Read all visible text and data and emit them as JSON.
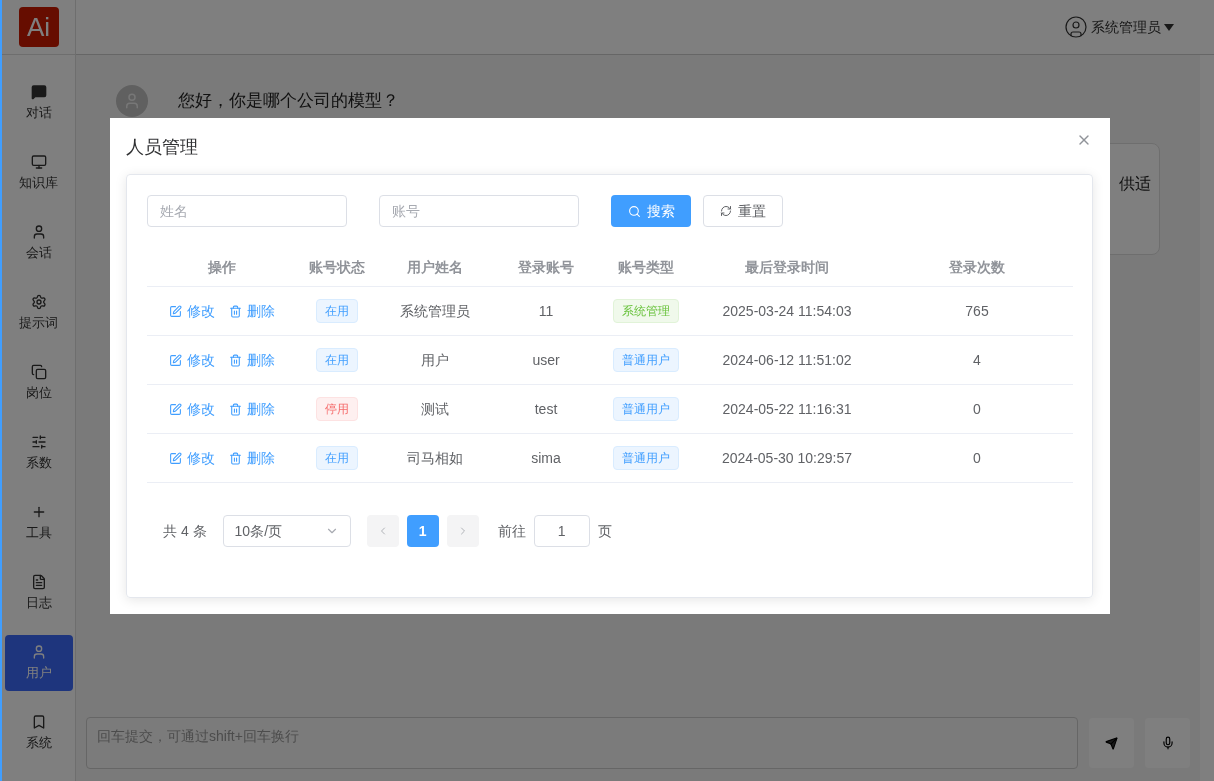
{
  "logo": "Ai",
  "sidebar": {
    "items": [
      {
        "label": "对话",
        "selected": false
      },
      {
        "label": "知识库",
        "selected": false
      },
      {
        "label": "会话",
        "selected": false
      },
      {
        "label": "提示词",
        "selected": false
      },
      {
        "label": "岗位",
        "selected": false
      },
      {
        "label": "系数",
        "selected": false
      },
      {
        "label": "工具",
        "selected": false
      },
      {
        "label": "日志",
        "selected": false
      },
      {
        "label": "用户",
        "selected": true
      },
      {
        "label": "系统",
        "selected": false
      }
    ]
  },
  "header": {
    "user": "系统管理员"
  },
  "chat": {
    "question": "您好，你是哪个公司的模型？",
    "answer_fragment": "供适"
  },
  "composer": {
    "placeholder": "回车提交，可通过shift+回车换行"
  },
  "modal": {
    "title": "人员管理",
    "filters": [
      {
        "placeholder": "姓名"
      },
      {
        "placeholder": "账号"
      }
    ],
    "search_button": "搜索",
    "reset_button": "重置",
    "table": {
      "columns": [
        "操作",
        "账号状态",
        "用户姓名",
        "登录账号",
        "账号类型",
        "最后登录时间",
        "登录次数"
      ],
      "rows": [
        {
          "edit": "修改",
          "delete": "删除",
          "status": {
            "text": "在用",
            "kind": "active"
          },
          "name": "系统管理员",
          "account": "11",
          "type": {
            "text": "系统管理",
            "kind": "admin"
          },
          "last_login": "2025-03-24 11:54:03",
          "count": "765"
        },
        {
          "edit": "修改",
          "delete": "删除",
          "status": {
            "text": "在用",
            "kind": "active"
          },
          "name": "用户",
          "account": "user",
          "type": {
            "text": "普通用户",
            "kind": "normal"
          },
          "last_login": "2024-06-12 11:51:02",
          "count": "4"
        },
        {
          "edit": "修改",
          "delete": "删除",
          "status": {
            "text": "停用",
            "kind": "disabled"
          },
          "name": "测试",
          "account": "test",
          "type": {
            "text": "普通用户",
            "kind": "normal"
          },
          "last_login": "2024-05-22 11:16:31",
          "count": "0"
        },
        {
          "edit": "修改",
          "delete": "删除",
          "status": {
            "text": "在用",
            "kind": "active"
          },
          "name": "司马相如",
          "account": "sima",
          "type": {
            "text": "普通用户",
            "kind": "normal"
          },
          "last_login": "2024-05-30 10:29:57",
          "count": "0"
        }
      ]
    },
    "pagination": {
      "total": "共 4 条",
      "page_size": "10条/页",
      "pages": [
        {
          "label": "1",
          "selected": true
        }
      ],
      "goto_label": "前往",
      "goto_value": "1",
      "goto_suffix": "页"
    }
  }
}
